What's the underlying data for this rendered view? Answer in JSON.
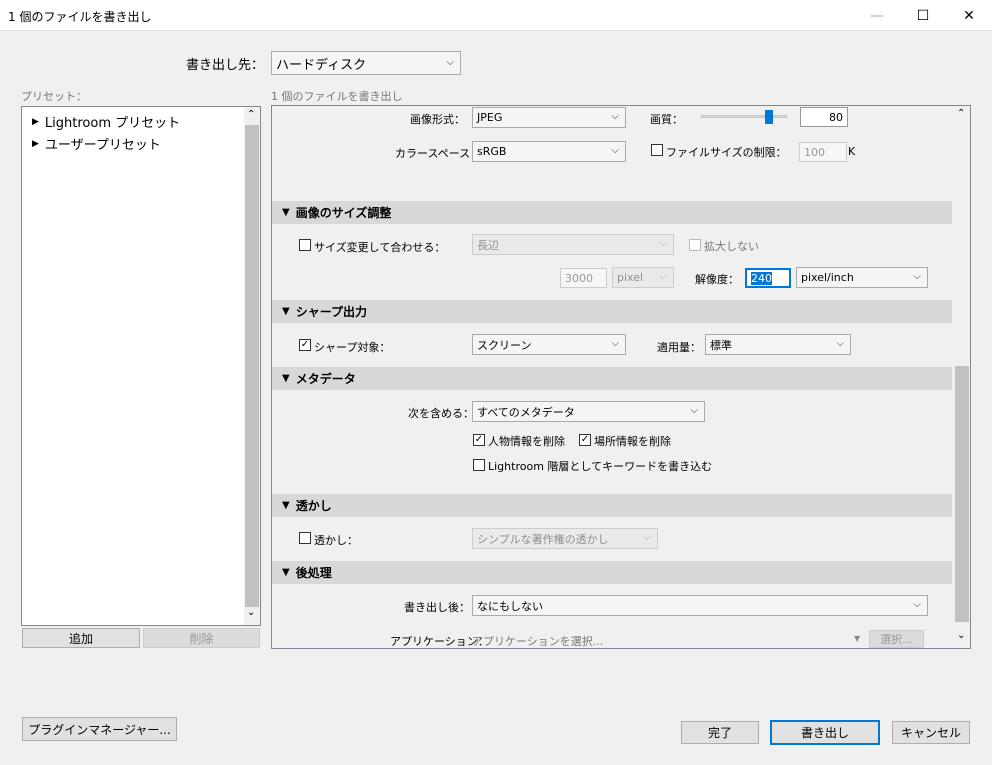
{
  "window": {
    "title": "1 個のファイルを書き出し",
    "minimize": "—",
    "maximize": "☐",
    "close": "✕"
  },
  "export_to": {
    "label": "書き出し先：",
    "value": "ハードディスク"
  },
  "presets": {
    "label": "プリセット：",
    "items": [
      "Lightroom プリセット",
      "ユーザープリセット"
    ],
    "add": "追加",
    "remove": "削除"
  },
  "subtitle": "1 個のファイルを書き出し",
  "file_settings": {
    "format_label": "画像形式：",
    "format_value": "JPEG",
    "quality_label": "画質：",
    "quality_value": "80",
    "quality_fraction": 0.8,
    "colorspace_label": "カラースペース：",
    "colorspace_value": "sRGB",
    "limit_label": "ファイルサイズの制限：",
    "limit_value": "100",
    "limit_unit": "K"
  },
  "sizing": {
    "header": "画像のサイズ調整",
    "resize_label": "サイズ変更して合わせる：",
    "resize_value": "長辺",
    "no_enlarge": "拡大しない",
    "size_value": "3000",
    "size_unit": "pixel",
    "resolution_label": "解像度：",
    "resolution_value": "240",
    "resolution_unit": "pixel/inch"
  },
  "sharpen": {
    "header": "シャープ出力",
    "target_label": "シャープ対象：",
    "target_value": "スクリーン",
    "amount_label": "適用量：",
    "amount_value": "標準"
  },
  "metadata": {
    "header": "メタデータ",
    "include_label": "次を含める：",
    "include_value": "すべてのメタデータ",
    "remove_person": "人物情報を削除",
    "remove_location": "場所情報を削除",
    "hierarchy": "Lightroom 階層としてキーワードを書き込む"
  },
  "watermark": {
    "header": "透かし",
    "label": "透かし：",
    "value": "シンプルな著作権の透かし"
  },
  "postprocess": {
    "header": "後処理",
    "after_label": "書き出し後：",
    "after_value": "なにもしない",
    "app_label": "アプリケーション：",
    "app_placeholder": "アプリケーションを選択...",
    "choose": "選択..."
  },
  "footer": {
    "plugin": "プラグインマネージャー...",
    "done": "完了",
    "export": "書き出し",
    "cancel": "キャンセル"
  },
  "glyphs": {
    "chev": "⌵",
    "check": "✓",
    "tri_down": "▼",
    "tri_right": "▶",
    "up": "⌃",
    "down": "⌄"
  }
}
